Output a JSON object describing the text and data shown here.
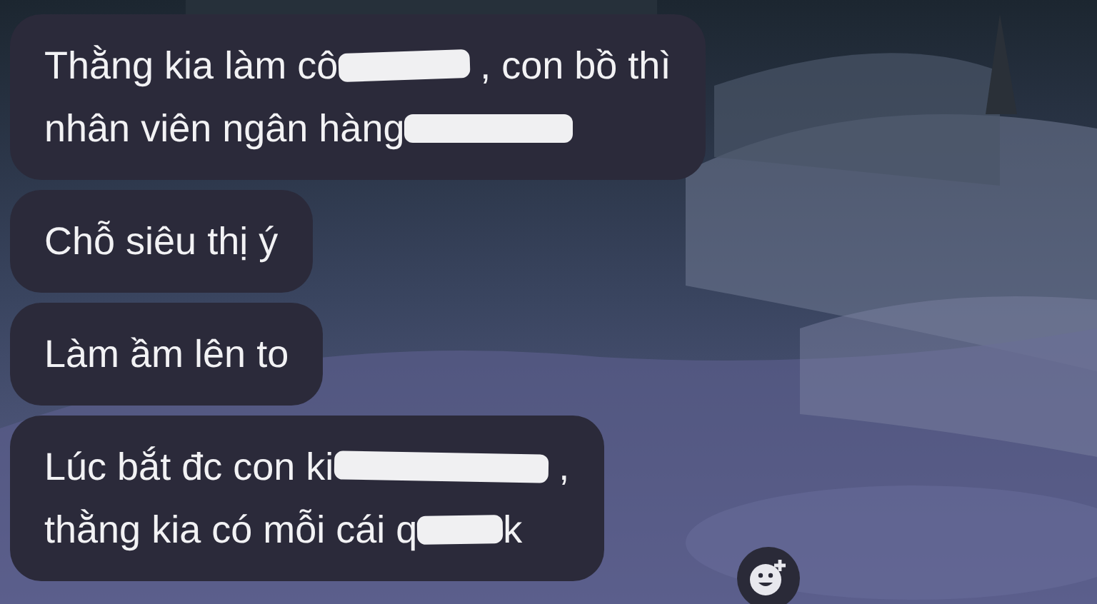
{
  "messages": [
    {
      "lines": [
        [
          {
            "kind": "text",
            "text": "Thằng kia làm cô"
          },
          {
            "kind": "redaction"
          },
          {
            "kind": "text",
            "text": " , con bồ thì"
          }
        ],
        [
          {
            "kind": "text",
            "text": "nhân viên ngân hàng"
          },
          {
            "kind": "redaction"
          }
        ]
      ]
    },
    {
      "lines": [
        [
          {
            "kind": "text",
            "text": "Chỗ siêu thị ý"
          }
        ]
      ]
    },
    {
      "lines": [
        [
          {
            "kind": "text",
            "text": "Làm ầm lên to"
          }
        ]
      ]
    },
    {
      "lines": [
        [
          {
            "kind": "text",
            "text": "Lúc bắt đc con ki"
          },
          {
            "kind": "redaction"
          },
          {
            "kind": "text",
            "text": " ,"
          }
        ],
        [
          {
            "kind": "text",
            "text": "thằng kia có mỗi cái q"
          },
          {
            "kind": "redaction"
          },
          {
            "kind": "text",
            "text": "k"
          }
        ]
      ]
    }
  ],
  "reaction_button": {
    "kind": "add-reaction"
  }
}
